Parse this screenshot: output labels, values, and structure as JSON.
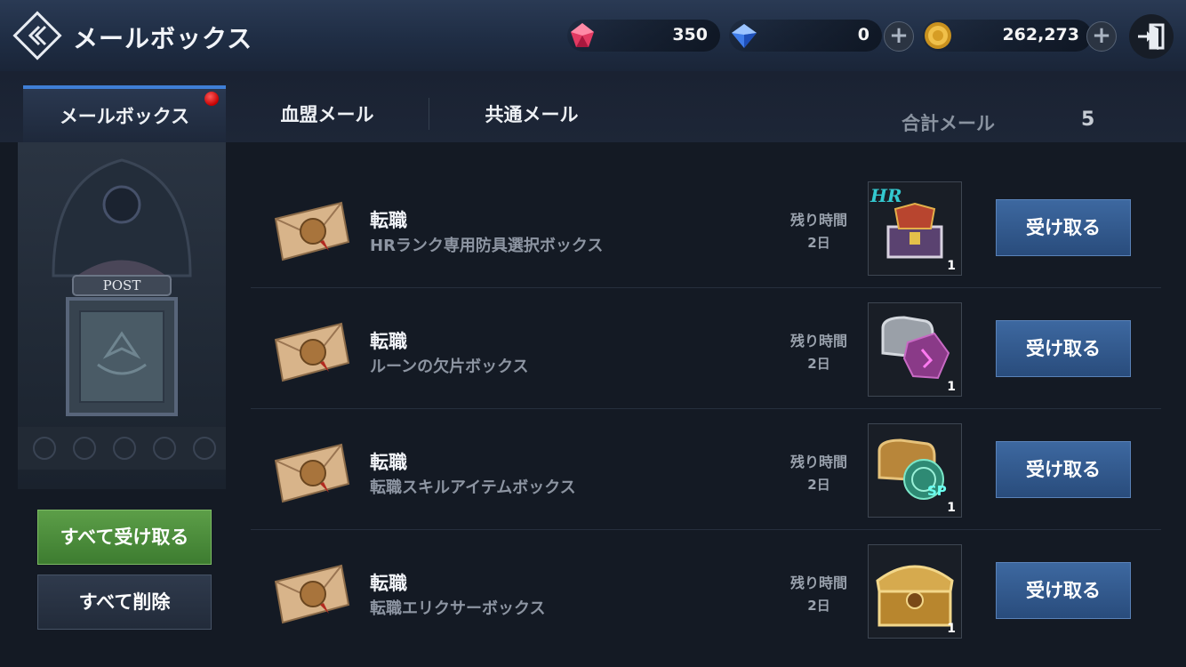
{
  "header": {
    "title": "メールボックス",
    "currencies": [
      {
        "name": "red-gem",
        "value": "350"
      },
      {
        "name": "blue-gem",
        "value": "0"
      },
      {
        "name": "gold-coin",
        "value": "262,273"
      }
    ]
  },
  "tabs": [
    {
      "label": "メールボックス",
      "active": true
    },
    {
      "label": "血盟メール",
      "active": false
    },
    {
      "label": "共通メール",
      "active": false
    }
  ],
  "total": {
    "label": "合計メール",
    "value": "5"
  },
  "post_sign": "POST",
  "buttons": {
    "receive_all": "すべて受け取る",
    "delete_all": "すべて削除"
  },
  "mails": [
    {
      "title": "転職",
      "subtitle": "HRランク専用防具選択ボックス",
      "remain_label": "残り時間",
      "remain_value": "2日",
      "item_icon": "hr-armor-chest-icon",
      "item_badge": "HR",
      "count": "1",
      "button": "受け取る"
    },
    {
      "title": "転職",
      "subtitle": "ルーンの欠片ボックス",
      "remain_label": "残り時間",
      "remain_value": "2日",
      "item_icon": "rune-shard-box-icon",
      "count": "1",
      "button": "受け取る"
    },
    {
      "title": "転職",
      "subtitle": "転職スキルアイテムボックス",
      "remain_label": "残り時間",
      "remain_value": "2日",
      "item_icon": "skill-item-box-icon",
      "item_badge": "SP",
      "count": "1",
      "button": "受け取る"
    },
    {
      "title": "転職",
      "subtitle": "転職エリクサーボックス",
      "remain_label": "残り時間",
      "remain_value": "2日",
      "item_icon": "elixir-chest-icon",
      "count": "1",
      "button": "受け取る"
    }
  ],
  "colors": {
    "accent_tab": "#3f7fd6",
    "receive_all": "#4a8c3a",
    "receive": "#2f5a92",
    "notification_dot": "#d40000"
  }
}
